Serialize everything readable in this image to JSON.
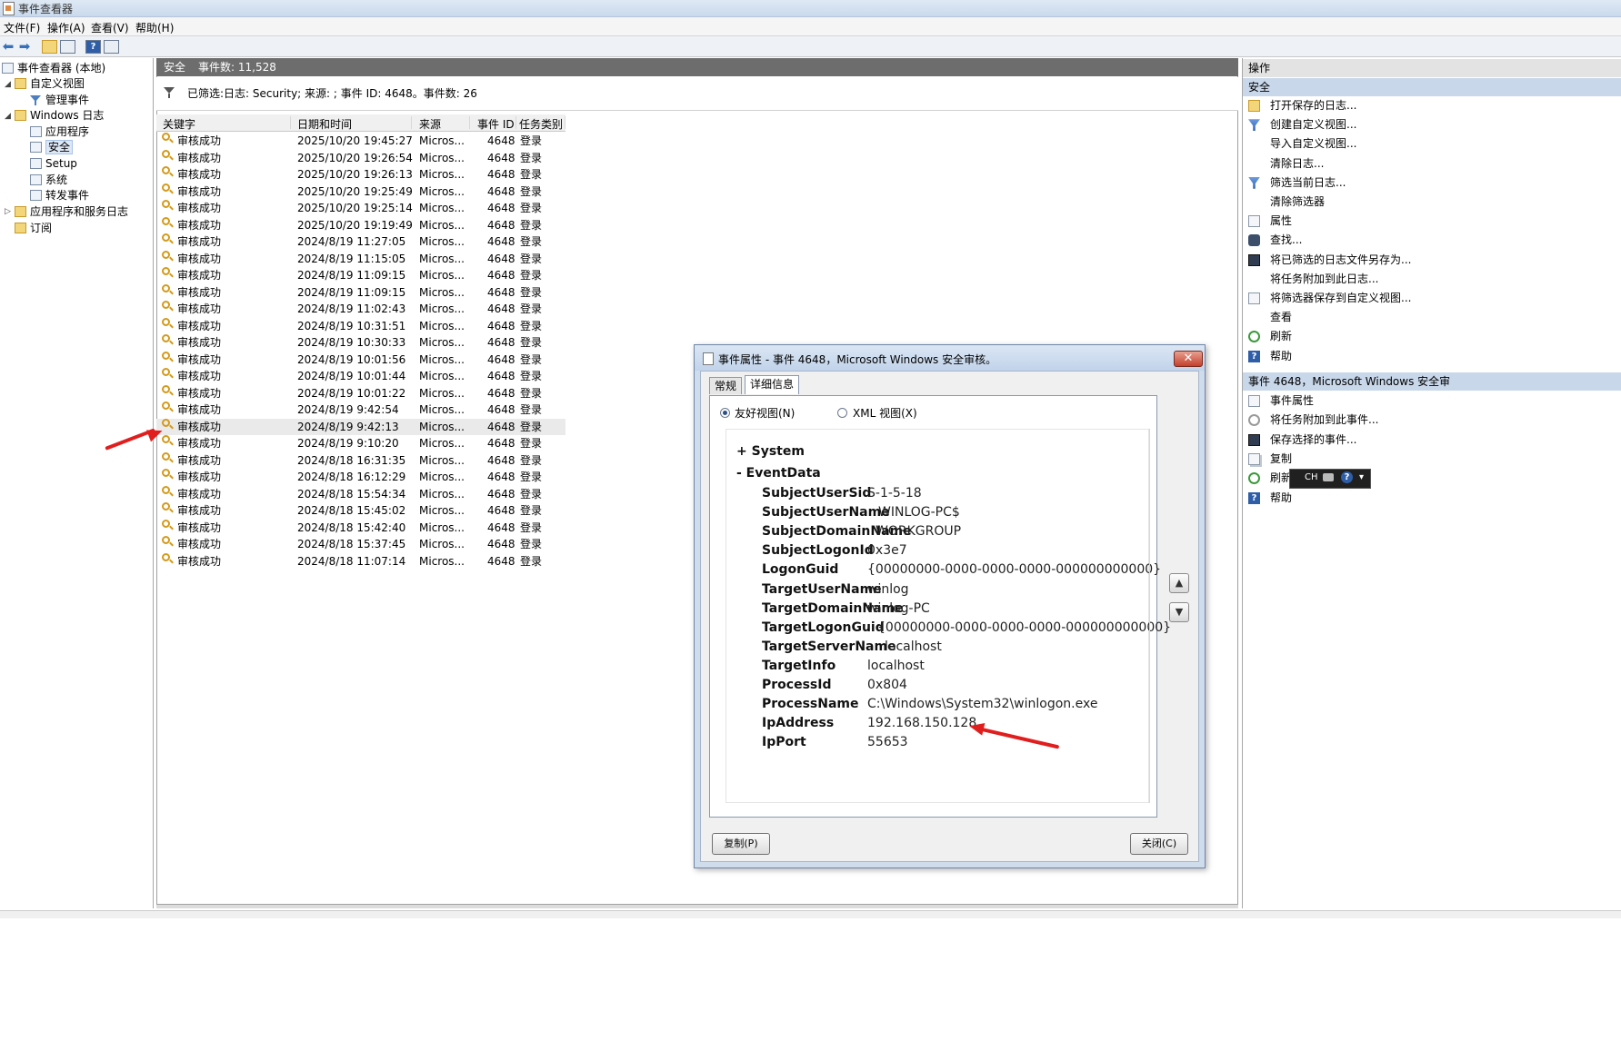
{
  "window": {
    "title": "事件查看器"
  },
  "menu": [
    "文件(F)",
    "操作(A)",
    "查看(V)",
    "帮助(H)"
  ],
  "tree": {
    "root": "事件查看器 (本地)",
    "custom_views": "自定义视图",
    "admin_events": "管理事件",
    "windows_logs": "Windows 日志",
    "application": "应用程序",
    "security": "安全",
    "setup": "Setup",
    "system": "系统",
    "forwarded": "转发事件",
    "app_services": "应用程序和服务日志",
    "subscriptions": "订阅"
  },
  "middle": {
    "log_name": "安全",
    "event_count": "事件数: 11,528",
    "filter_text": "已筛选:日志: Security; 来源: ; 事件 ID: 4648。事件数: 26",
    "columns": [
      "关键字",
      "日期和时间",
      "来源",
      "事件 ID",
      "任务类别"
    ],
    "rows": [
      {
        "kw": "审核成功",
        "dt": "2025/10/20 19:45:27",
        "src": "Micros...",
        "id": "4648",
        "cat": "登录"
      },
      {
        "kw": "审核成功",
        "dt": "2025/10/20 19:26:54",
        "src": "Micros...",
        "id": "4648",
        "cat": "登录"
      },
      {
        "kw": "审核成功",
        "dt": "2025/10/20 19:26:13",
        "src": "Micros...",
        "id": "4648",
        "cat": "登录"
      },
      {
        "kw": "审核成功",
        "dt": "2025/10/20 19:25:49",
        "src": "Micros...",
        "id": "4648",
        "cat": "登录"
      },
      {
        "kw": "审核成功",
        "dt": "2025/10/20 19:25:14",
        "src": "Micros...",
        "id": "4648",
        "cat": "登录"
      },
      {
        "kw": "审核成功",
        "dt": "2025/10/20 19:19:49",
        "src": "Micros...",
        "id": "4648",
        "cat": "登录"
      },
      {
        "kw": "审核成功",
        "dt": "2024/8/19 11:27:05",
        "src": "Micros...",
        "id": "4648",
        "cat": "登录"
      },
      {
        "kw": "审核成功",
        "dt": "2024/8/19 11:15:05",
        "src": "Micros...",
        "id": "4648",
        "cat": "登录"
      },
      {
        "kw": "审核成功",
        "dt": "2024/8/19 11:09:15",
        "src": "Micros...",
        "id": "4648",
        "cat": "登录"
      },
      {
        "kw": "审核成功",
        "dt": "2024/8/19 11:09:15",
        "src": "Micros...",
        "id": "4648",
        "cat": "登录"
      },
      {
        "kw": "审核成功",
        "dt": "2024/8/19 11:02:43",
        "src": "Micros...",
        "id": "4648",
        "cat": "登录"
      },
      {
        "kw": "审核成功",
        "dt": "2024/8/19 10:31:51",
        "src": "Micros...",
        "id": "4648",
        "cat": "登录"
      },
      {
        "kw": "审核成功",
        "dt": "2024/8/19 10:30:33",
        "src": "Micros...",
        "id": "4648",
        "cat": "登录"
      },
      {
        "kw": "审核成功",
        "dt": "2024/8/19 10:01:56",
        "src": "Micros...",
        "id": "4648",
        "cat": "登录"
      },
      {
        "kw": "审核成功",
        "dt": "2024/8/19 10:01:44",
        "src": "Micros...",
        "id": "4648",
        "cat": "登录"
      },
      {
        "kw": "审核成功",
        "dt": "2024/8/19 10:01:22",
        "src": "Micros...",
        "id": "4648",
        "cat": "登录"
      },
      {
        "kw": "审核成功",
        "dt": "2024/8/19 9:42:54",
        "src": "Micros...",
        "id": "4648",
        "cat": "登录"
      },
      {
        "kw": "审核成功",
        "dt": "2024/8/19 9:42:13",
        "src": "Micros...",
        "id": "4648",
        "cat": "登录"
      },
      {
        "kw": "审核成功",
        "dt": "2024/8/19 9:10:20",
        "src": "Micros...",
        "id": "4648",
        "cat": "登录"
      },
      {
        "kw": "审核成功",
        "dt": "2024/8/18 16:31:35",
        "src": "Micros...",
        "id": "4648",
        "cat": "登录"
      },
      {
        "kw": "审核成功",
        "dt": "2024/8/18 16:12:29",
        "src": "Micros...",
        "id": "4648",
        "cat": "登录"
      },
      {
        "kw": "审核成功",
        "dt": "2024/8/18 15:54:34",
        "src": "Micros...",
        "id": "4648",
        "cat": "登录"
      },
      {
        "kw": "审核成功",
        "dt": "2024/8/18 15:45:02",
        "src": "Micros...",
        "id": "4648",
        "cat": "登录"
      },
      {
        "kw": "审核成功",
        "dt": "2024/8/18 15:42:40",
        "src": "Micros...",
        "id": "4648",
        "cat": "登录"
      },
      {
        "kw": "审核成功",
        "dt": "2024/8/18 15:37:45",
        "src": "Micros...",
        "id": "4648",
        "cat": "登录"
      },
      {
        "kw": "审核成功",
        "dt": "2024/8/18 11:07:14",
        "src": "Micros...",
        "id": "4648",
        "cat": "登录"
      }
    ],
    "selected_row": 17
  },
  "actions": {
    "header": "操作",
    "section1": "安全",
    "items1": [
      {
        "label": "打开保存的日志...",
        "icon": "open-folder-icon"
      },
      {
        "label": "创建自定义视图...",
        "icon": "create-filter-icon"
      },
      {
        "label": "导入自定义视图...",
        "icon": ""
      },
      {
        "label": "清除日志...",
        "icon": ""
      },
      {
        "label": "筛选当前日志...",
        "icon": "filter-icon"
      },
      {
        "label": "清除筛选器",
        "icon": ""
      },
      {
        "label": "属性",
        "icon": "properties-icon"
      },
      {
        "label": "查找...",
        "icon": "binoculars-icon"
      },
      {
        "label": "将已筛选的日志文件另存为...",
        "icon": "save-disk-icon"
      },
      {
        "label": "将任务附加到此日志...",
        "icon": ""
      },
      {
        "label": "将筛选器保存到自定义视图...",
        "icon": "save-filter-icon"
      },
      {
        "label": "查看",
        "icon": ""
      },
      {
        "label": "刷新",
        "icon": "refresh-icon"
      },
      {
        "label": "帮助",
        "icon": "help-icon"
      }
    ],
    "section2": "事件 4648，Microsoft Windows 安全审",
    "items2": [
      {
        "label": "事件属性",
        "icon": "properties-icon"
      },
      {
        "label": "将任务附加到此事件...",
        "icon": "task-icon"
      },
      {
        "label": "保存选择的事件...",
        "icon": "save-disk-icon"
      },
      {
        "label": "复制",
        "icon": "copy-icon"
      },
      {
        "label": "刷新",
        "icon": "refresh-icon"
      },
      {
        "label": "帮助",
        "icon": "help-icon"
      }
    ]
  },
  "ime": {
    "label": "CH"
  },
  "dialog": {
    "title": "事件属性 - 事件 4648，Microsoft Windows 安全审核。",
    "tab_general": "常规",
    "tab_details": "详细信息",
    "radio_friendly": "友好视图(N)",
    "radio_xml": "XML 视图(X)",
    "system_label": "+  System",
    "eventdata_label": "-  EventData",
    "fields": [
      {
        "k": "SubjectUserSid",
        "v": "S-1-5-18"
      },
      {
        "k": "SubjectUserName",
        "v": "WINLOG-PC$"
      },
      {
        "k": "SubjectDomainName",
        "v": "WORKGROUP"
      },
      {
        "k": "SubjectLogonId",
        "v": "0x3e7"
      },
      {
        "k": "LogonGuid",
        "v": "{00000000-0000-0000-0000-000000000000}"
      },
      {
        "k": "TargetUserName",
        "v": "winlog"
      },
      {
        "k": "TargetDomainName",
        "v": "winlog-PC"
      },
      {
        "k": "TargetLogonGuid",
        "v": "{00000000-0000-0000-0000-000000000000}"
      },
      {
        "k": "TargetServerName",
        "v": "localhost"
      },
      {
        "k": "TargetInfo",
        "v": "localhost"
      },
      {
        "k": "ProcessId",
        "v": "0x804"
      },
      {
        "k": "ProcessName",
        "v": "C:\\Windows\\System32\\winlogon.exe"
      },
      {
        "k": "IpAddress",
        "v": "192.168.150.128"
      },
      {
        "k": "IpPort",
        "v": "55653"
      }
    ],
    "copy_button": "复制(P)",
    "close_button": "关闭(C)"
  }
}
